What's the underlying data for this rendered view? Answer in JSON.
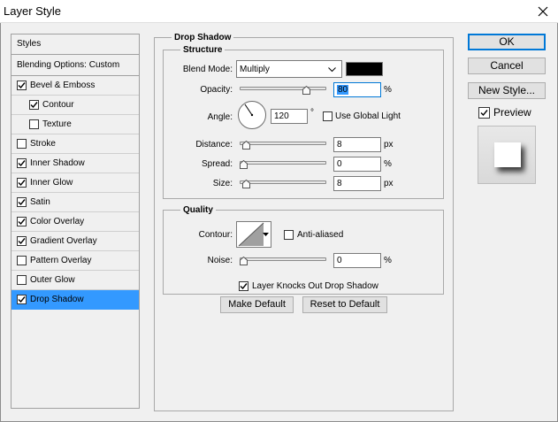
{
  "window": {
    "title": "Layer Style"
  },
  "styles_panel": {
    "header": "Styles",
    "blending": "Blending Options: Custom",
    "items": [
      {
        "label": "Bevel & Emboss",
        "checked": true
      },
      {
        "label": "Contour",
        "checked": true,
        "indent": true
      },
      {
        "label": "Texture",
        "checked": false,
        "indent": true
      },
      {
        "label": "Stroke",
        "checked": false
      },
      {
        "label": "Inner Shadow",
        "checked": true
      },
      {
        "label": "Inner Glow",
        "checked": true
      },
      {
        "label": "Satin",
        "checked": true
      },
      {
        "label": "Color Overlay",
        "checked": true
      },
      {
        "label": "Gradient Overlay",
        "checked": true
      },
      {
        "label": "Pattern Overlay",
        "checked": false
      },
      {
        "label": "Outer Glow",
        "checked": false
      },
      {
        "label": "Drop Shadow",
        "checked": true,
        "selected": true
      }
    ]
  },
  "drop_shadow": {
    "title": "Drop Shadow",
    "structure": {
      "title": "Structure",
      "blend_mode_label": "Blend Mode:",
      "blend_mode_value": "Multiply",
      "shadow_color": "#000000",
      "opacity_label": "Opacity:",
      "opacity_value": "80",
      "opacity_unit": "%",
      "opacity_level": 0.8,
      "angle_label": "Angle:",
      "angle_value": "120",
      "angle_unit": "°",
      "use_global_light_label": "Use Global Light",
      "use_global_light": false,
      "distance_label": "Distance:",
      "distance_value": "8",
      "distance_unit": "px",
      "distance_level": 0.03,
      "spread_label": "Spread:",
      "spread_value": "0",
      "spread_unit": "%",
      "spread_level": 0,
      "size_label": "Size:",
      "size_value": "8",
      "size_unit": "px",
      "size_level": 0.03
    },
    "quality": {
      "title": "Quality",
      "contour_label": "Contour:",
      "anti_aliased_label": "Anti-aliased",
      "anti_aliased": false,
      "noise_label": "Noise:",
      "noise_value": "0",
      "noise_unit": "%",
      "noise_level": 0
    },
    "knockout_label": "Layer Knocks Out Drop Shadow",
    "knockout": true,
    "make_default_label": "Make Default",
    "reset_default_label": "Reset to Default"
  },
  "actions": {
    "ok_label": "OK",
    "cancel_label": "Cancel",
    "new_style_label": "New Style...",
    "preview_label": "Preview",
    "preview_checked": true
  },
  "colors": {
    "accent": "#0078d7",
    "selection": "#3399ff"
  }
}
